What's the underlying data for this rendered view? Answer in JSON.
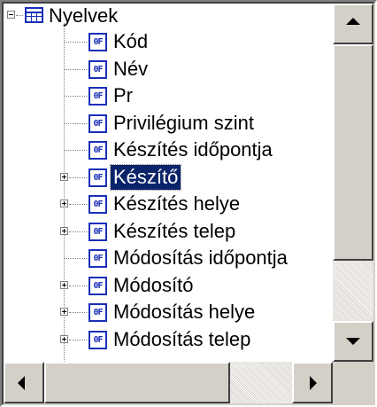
{
  "tree": {
    "root": {
      "label": "Nyelvek",
      "icon": "table-icon",
      "expander": "minus"
    },
    "items": [
      {
        "label": "Kód",
        "expander": "none",
        "selected": false
      },
      {
        "label": "Név",
        "expander": "none",
        "selected": false
      },
      {
        "label": "Pr",
        "expander": "none",
        "selected": false
      },
      {
        "label": "Privilégium szint",
        "expander": "none",
        "selected": false
      },
      {
        "label": "Készítés időpontja",
        "expander": "none",
        "selected": false
      },
      {
        "label": "Készítő",
        "expander": "plus",
        "selected": true
      },
      {
        "label": "Készítés helye",
        "expander": "plus",
        "selected": false
      },
      {
        "label": "Készítés telep",
        "expander": "plus",
        "selected": false
      },
      {
        "label": "Módosítás időpontja",
        "expander": "none",
        "selected": false
      },
      {
        "label": "Módosító",
        "expander": "plus",
        "selected": false
      },
      {
        "label": "Módosítás helye",
        "expander": "plus",
        "selected": false
      },
      {
        "label": "Módosítás telep",
        "expander": "plus",
        "selected": false
      }
    ],
    "item_icon_text": "0F"
  },
  "colors": {
    "selection": "#0a246a",
    "icon_blue": "#1a2fb8",
    "face": "#d4d0c8"
  }
}
